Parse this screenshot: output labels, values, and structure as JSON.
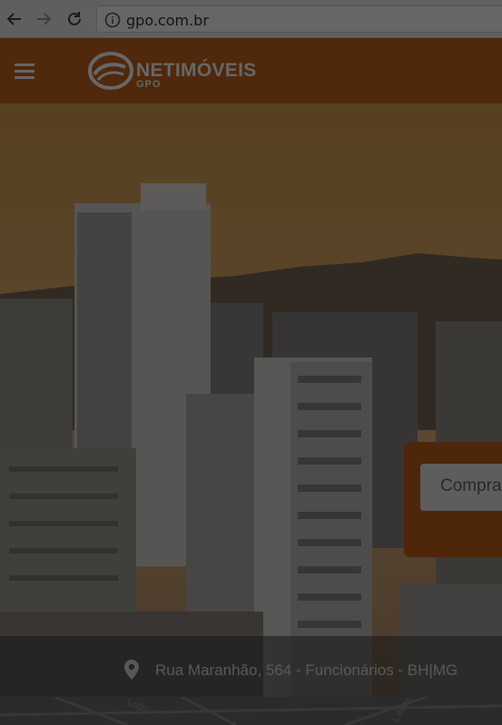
{
  "browser": {
    "url": "gpo.com.br"
  },
  "site": {
    "logo_text": "NETIMÓVEIS",
    "logo_sub": "GPO"
  },
  "search": {
    "select_value": "Compra"
  },
  "footer": {
    "address": "Rua Maranhão, 564 - Funcionários - BH|MG"
  },
  "map": {
    "labels": [
      "Lobo",
      "Libras"
    ]
  },
  "icons": {
    "back": "arrow-left-icon",
    "forward": "arrow-right-icon",
    "reload": "reload-icon",
    "info": "info-icon",
    "menu": "hamburger-icon",
    "location": "map-pin-icon"
  },
  "colors": {
    "brand_orange": "#c8651d",
    "overlay": "rgba(0,0,0,0.6)"
  }
}
